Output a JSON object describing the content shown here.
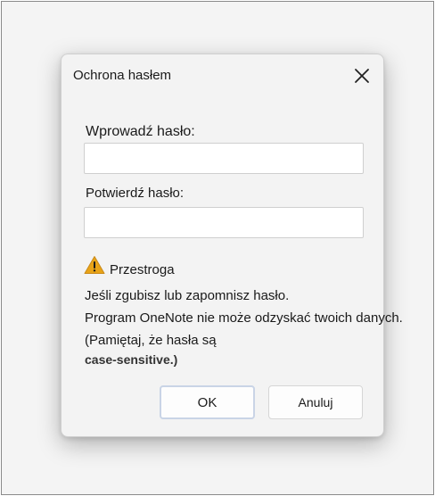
{
  "dialog": {
    "title": "Ochrona hasłem",
    "close_icon": "close-icon",
    "password_label": "Wprowadź hasło:",
    "password_value": "",
    "confirm_label": "Potwierdź hasło:",
    "confirm_value": "",
    "warning": {
      "icon": "warning-icon",
      "title": "Przestroga",
      "lines": [
        "Jeśli zgubisz lub zapomnisz hasło.",
        "Program OneNote nie może odzyskać twoich danych.",
        "(Pamiętaj, że hasła są",
        "case-sensitive.)"
      ]
    },
    "ok_label": "OK",
    "cancel_label": "Anuluj",
    "warning_color": "#e8a317"
  }
}
